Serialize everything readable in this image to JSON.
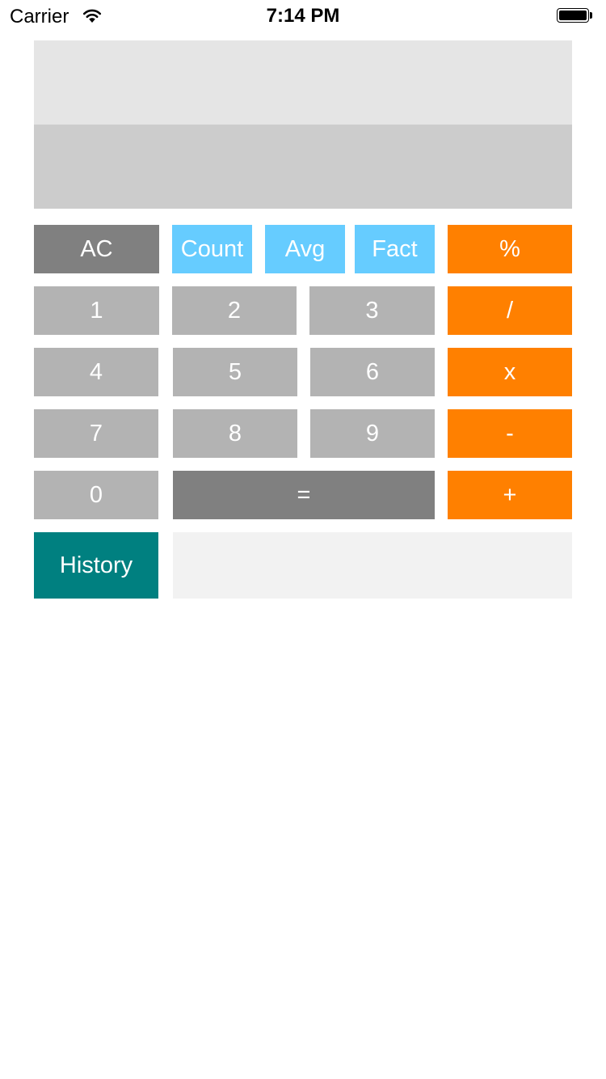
{
  "status_bar": {
    "carrier": "Carrier",
    "time": "7:14 PM"
  },
  "display": {
    "expression": "",
    "result": ""
  },
  "keys": {
    "clear": "AC",
    "count": "Count",
    "avg": "Avg",
    "fact": "Fact",
    "percent": "%",
    "one": "1",
    "two": "2",
    "three": "3",
    "divide": "/",
    "four": "4",
    "five": "5",
    "six": "6",
    "multiply": "x",
    "seven": "7",
    "eight": "8",
    "nine": "9",
    "minus": "-",
    "zero": "0",
    "equals": "=",
    "plus": "+",
    "history": "History"
  },
  "history_output": "",
  "colors": {
    "function_key": "#808080",
    "digit_key": "#b3b3b3",
    "stat_key": "#66ccff",
    "operator_key": "#ff8000",
    "history_key": "#008080",
    "display_top": "#e5e5e5",
    "display_bottom": "#cccccc"
  },
  "icons": [
    "wifi-icon",
    "battery-icon"
  ]
}
